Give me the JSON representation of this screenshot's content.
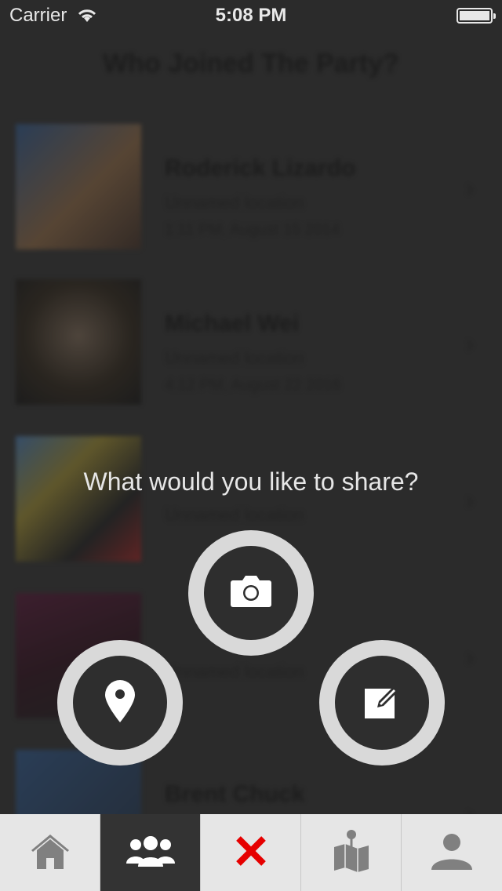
{
  "status_bar": {
    "carrier": "Carrier",
    "time": "5:08 PM"
  },
  "page": {
    "title": "Who Joined The Party?"
  },
  "list": [
    {
      "name": "Roderick Lizardo",
      "location": "Unnamed location",
      "date": "1:11 PM, August 15 2014"
    },
    {
      "name": "Michael Wei",
      "location": "Unnamed location",
      "date": "4:12 PM, August 22 2016"
    },
    {
      "name": "",
      "location": "Unnamed location",
      "date": ""
    },
    {
      "name": "",
      "location": "Unnamed location",
      "date": ""
    },
    {
      "name": "Brent Chuck",
      "location": "",
      "date": ""
    }
  ],
  "overlay": {
    "prompt": "What would you like to share?",
    "actions": [
      {
        "icon": "camera-icon"
      },
      {
        "icon": "location-pin-icon"
      },
      {
        "icon": "compose-icon"
      }
    ]
  },
  "tabs": [
    {
      "icon": "home-icon",
      "active": false
    },
    {
      "icon": "people-icon",
      "active": true
    },
    {
      "icon": "close-icon",
      "active": false
    },
    {
      "icon": "map-icon",
      "active": false
    },
    {
      "icon": "profile-icon",
      "active": false
    }
  ],
  "colors": {
    "close_red": "#e60000",
    "ring": "#d9d9d9",
    "button_fill": "#2e2e2e",
    "tabbar_bg": "#e6e6e6",
    "active_tab_bg": "#333333"
  }
}
